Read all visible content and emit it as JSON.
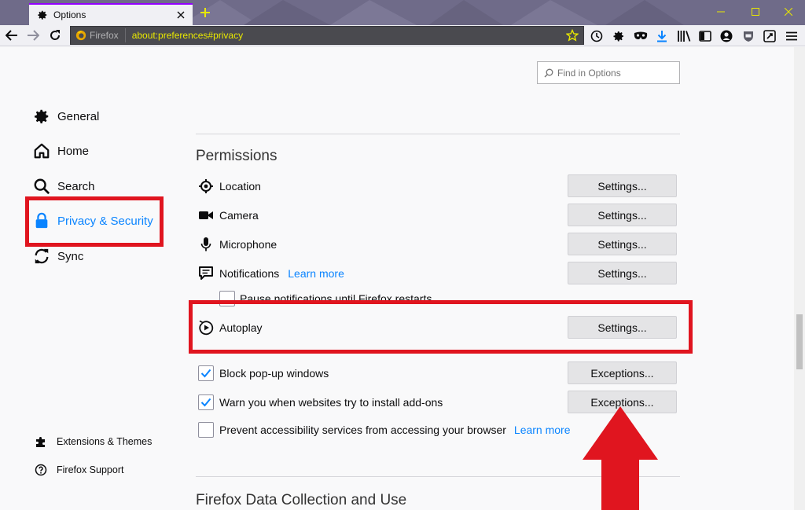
{
  "tab": {
    "title": "Options"
  },
  "urlbar": {
    "identity_label": "Firefox",
    "url": "about:preferences#privacy"
  },
  "find": {
    "placeholder": "Find in Options"
  },
  "sidebar": {
    "categories": [
      {
        "label": "General",
        "icon": "gear-icon"
      },
      {
        "label": "Home",
        "icon": "home-icon"
      },
      {
        "label": "Search",
        "icon": "search-icon"
      },
      {
        "label": "Privacy & Security",
        "icon": "lock-icon",
        "selected": true
      },
      {
        "label": "Sync",
        "icon": "sync-icon"
      }
    ],
    "footer": [
      {
        "label": "Extensions & Themes",
        "icon": "puzzle-icon"
      },
      {
        "label": "Firefox Support",
        "icon": "help-icon"
      }
    ]
  },
  "permissions": {
    "title": "Permissions",
    "rows": [
      {
        "label": "Location",
        "icon": "location-icon",
        "button": "Settings..."
      },
      {
        "label": "Camera",
        "icon": "camera-icon",
        "button": "Settings..."
      },
      {
        "label": "Microphone",
        "icon": "microphone-icon",
        "button": "Settings..."
      },
      {
        "label": "Notifications",
        "icon": "notification-icon",
        "link": "Learn more",
        "button": "Settings..."
      },
      {
        "label": "Autoplay",
        "icon": "autoplay-icon",
        "button": "Settings..."
      }
    ],
    "pause_notifications": "Pause notifications until Firefox restarts",
    "block_popups": {
      "label": "Block pop-up windows",
      "checked": true,
      "button": "Exceptions..."
    },
    "warn_addons": {
      "label": "Warn you when websites try to install add-ons",
      "checked": true,
      "button": "Exceptions..."
    },
    "accessibility": {
      "label": "Prevent accessibility services from accessing your browser",
      "checked": false,
      "link": "Learn more"
    }
  },
  "next_section": {
    "title": "Firefox Data Collection and Use"
  },
  "colors": {
    "accent": "#0a84ff",
    "highlight": "#e0151f",
    "titlebar": "#6f6b89",
    "urlbar": "#4a4a4f",
    "url_text": "#e8e800"
  }
}
